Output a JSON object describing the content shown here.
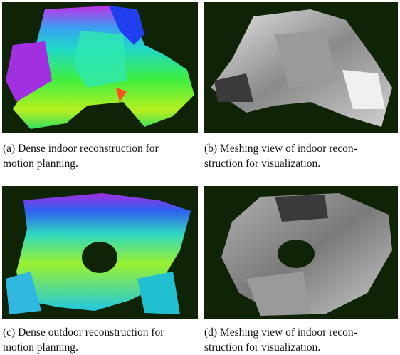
{
  "figures": [
    {
      "label": "(a)",
      "caption_line1": "(a) Dense indoor reconstruction for",
      "caption_line2": "motion planning."
    },
    {
      "label": "(b)",
      "caption_line1": "(b) Meshing view of indoor recon-",
      "caption_line2": "struction for visualization."
    },
    {
      "label": "(c)",
      "caption_line1": "(c) Dense outdoor reconstruction for",
      "caption_line2": "motion planning."
    },
    {
      "label": "(d)",
      "caption_line1": "(d) Meshing view of indoor recon-",
      "caption_line2": "struction for visualization."
    }
  ],
  "colors": {
    "panel_background": "#0f2306",
    "heatmap_low": "#22ee22",
    "heatmap_mid": "#1ec8d6",
    "heatmap_high": "#b020e0"
  }
}
